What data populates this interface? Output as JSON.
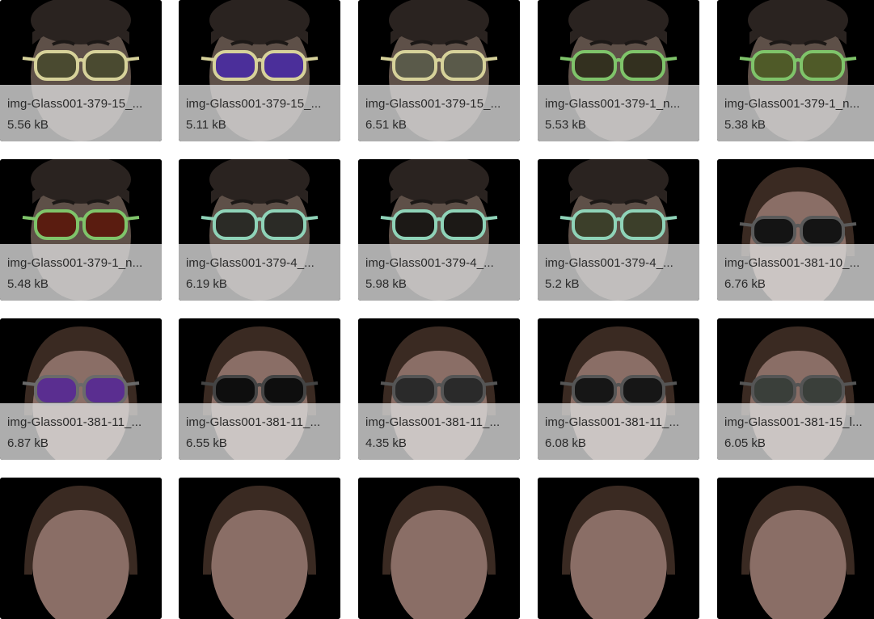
{
  "gallery": {
    "items": [
      {
        "name": "img-Glass001-379-15_...",
        "size": "5.56 kB",
        "subject": "man",
        "frame_color": "#d7d29a",
        "lens_color": "#4a4a30"
      },
      {
        "name": "img-Glass001-379-15_...",
        "size": "5.11 kB",
        "subject": "man",
        "frame_color": "#d7d29a",
        "lens_color": "#4b2f9a"
      },
      {
        "name": "img-Glass001-379-15_...",
        "size": "6.51 kB",
        "subject": "man",
        "frame_color": "#d7d29a",
        "lens_color": "#5a5a4a"
      },
      {
        "name": "img-Glass001-379-1_n...",
        "size": "5.53 kB",
        "subject": "man",
        "frame_color": "#7fc46a",
        "lens_color": "#33301f"
      },
      {
        "name": "img-Glass001-379-1_n...",
        "size": "5.38 kB",
        "subject": "man",
        "frame_color": "#7fc46a",
        "lens_color": "#4f5a28"
      },
      {
        "name": "img-Glass001-379-1_n...",
        "size": "5.48 kB",
        "subject": "man",
        "frame_color": "#7fc46a",
        "lens_color": "#5a1c10"
      },
      {
        "name": "img-Glass001-379-4_...",
        "size": "6.19 kB",
        "subject": "man",
        "frame_color": "#8fd3b8",
        "lens_color": "#2b2b26"
      },
      {
        "name": "img-Glass001-379-4_...",
        "size": "5.98 kB",
        "subject": "man",
        "frame_color": "#8fd3b8",
        "lens_color": "#1c1916"
      },
      {
        "name": "img-Glass001-379-4_...",
        "size": "5.2 kB",
        "subject": "man",
        "frame_color": "#8fd3b8",
        "lens_color": "#3c3f2a"
      },
      {
        "name": "img-Glass001-381-10_...",
        "size": "6.76 kB",
        "subject": "woman",
        "frame_color": "#5a5a5a",
        "lens_color": "#141414"
      },
      {
        "name": "img-Glass001-381-11_...",
        "size": "6.87 kB",
        "subject": "woman",
        "frame_color": "#6a6a6a",
        "lens_color": "#5a2e90"
      },
      {
        "name": "img-Glass001-381-11_...",
        "size": "6.55 kB",
        "subject": "woman",
        "frame_color": "#444444",
        "lens_color": "#0e0e0e"
      },
      {
        "name": "img-Glass001-381-11_...",
        "size": "4.35 kB",
        "subject": "woman",
        "frame_color": "#555555",
        "lens_color": "#2a2a2a"
      },
      {
        "name": "img-Glass001-381-11_...",
        "size": "6.08 kB",
        "subject": "woman",
        "frame_color": "#555555",
        "lens_color": "#161616"
      },
      {
        "name": "img-Glass001-381-15_l...",
        "size": "6.05 kB",
        "subject": "woman",
        "frame_color": "#555555",
        "lens_color": "#3a3f3a"
      },
      {
        "subject": "woman"
      },
      {
        "subject": "woman"
      },
      {
        "subject": "woman"
      },
      {
        "subject": "woman"
      },
      {
        "subject": "woman"
      }
    ]
  }
}
